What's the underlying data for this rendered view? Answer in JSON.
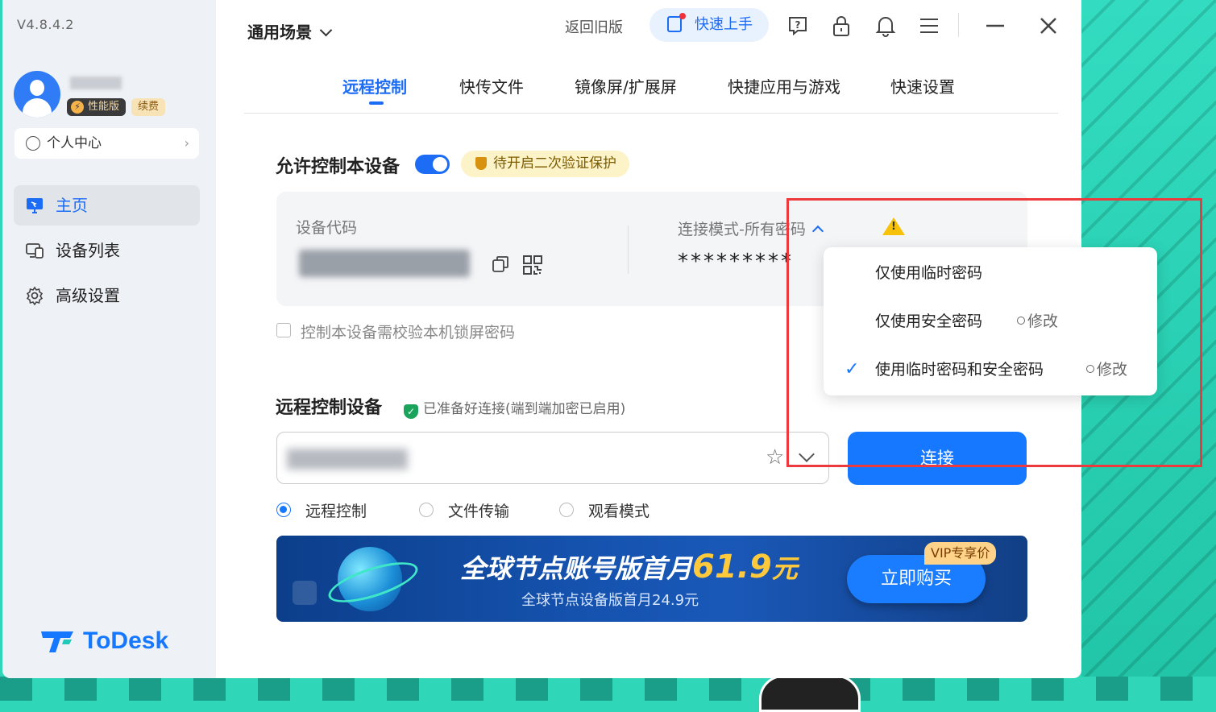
{
  "app": {
    "version": "V4.8.4.2",
    "brand": "ToDesk",
    "accent": "#1677ff"
  },
  "user": {
    "badge_performance": "性能版",
    "badge_renew": "续费",
    "personal_center": "个人中心"
  },
  "sidebar": {
    "items": [
      {
        "label": "主页",
        "icon": "monitor-icon",
        "active": true
      },
      {
        "label": "设备列表",
        "icon": "devices-icon",
        "active": false
      },
      {
        "label": "高级设置",
        "icon": "gear-icon",
        "active": false
      }
    ]
  },
  "topbar": {
    "scene": "通用场景",
    "back_old": "返回旧版",
    "quick_start": "快速上手",
    "icons": [
      "help-icon",
      "lock-icon",
      "bell-icon",
      "menu-icon",
      "minimize-icon",
      "close-icon"
    ]
  },
  "tabs": [
    {
      "label": "远程控制",
      "active": true
    },
    {
      "label": "快传文件",
      "active": false
    },
    {
      "label": "镜像屏/扩展屏",
      "active": false
    },
    {
      "label": "快捷应用与游戏",
      "active": false
    },
    {
      "label": "快速设置",
      "active": false
    }
  ],
  "allow": {
    "title": "允许控制本设备",
    "toggle_on": true,
    "warning": "待开启二次验证保护"
  },
  "device": {
    "code_label": "设备代码",
    "mode_label": "连接模式-所有密码",
    "password_mask": "*********",
    "lock_screen_check": "控制本设备需校验本机锁屏密码"
  },
  "remote": {
    "title": "远程控制设备",
    "ready_note": "已准备好连接(端到端加密已启用)",
    "connect": "连接",
    "modes": [
      {
        "label": "远程控制",
        "selected": true
      },
      {
        "label": "文件传输",
        "selected": false
      },
      {
        "label": "观看模式",
        "selected": false
      }
    ]
  },
  "banner": {
    "main_prefix": "全球节点账号版首月",
    "price": "61.9",
    "unit": "元",
    "sub": "全球节点设备版首月24.9元",
    "buy": "立即购买",
    "vip_tag": "VIP专享价"
  },
  "dropdown": {
    "items": [
      {
        "label": "仅使用临时密码",
        "checked": false,
        "edit": ""
      },
      {
        "label": "仅使用安全密码",
        "checked": false,
        "edit": "修改"
      },
      {
        "label": "使用临时密码和安全密码",
        "checked": true,
        "edit": "修改"
      }
    ]
  }
}
